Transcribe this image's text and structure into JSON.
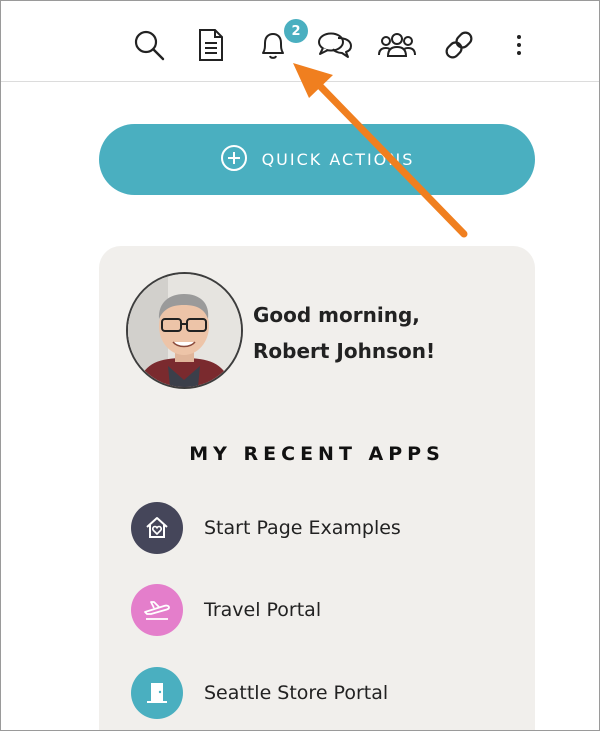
{
  "header": {
    "icons": [
      {
        "name": "search-icon"
      },
      {
        "name": "document-icon"
      },
      {
        "name": "bell-icon"
      },
      {
        "name": "chat-icon"
      },
      {
        "name": "people-icon"
      },
      {
        "name": "link-icon"
      },
      {
        "name": "more-vertical-icon"
      }
    ],
    "notification_count": "2"
  },
  "quick_actions": {
    "label": "QUICK ACTIONS",
    "icon": "plus-circle-icon"
  },
  "card": {
    "greeting_line1": "Good morning,",
    "greeting_line2": "Robert Johnson!",
    "section_title": "MY RECENT APPS",
    "apps": [
      {
        "label": "Start Page Examples",
        "icon": "home-heart-icon",
        "color": "#45465a"
      },
      {
        "label": "Travel Portal",
        "icon": "plane-icon",
        "color": "#e47ecb"
      },
      {
        "label": "Seattle Store Portal",
        "icon": "store-door-icon",
        "color": "#4aafc0"
      }
    ]
  },
  "colors": {
    "accent": "#4aafc0",
    "card_bg": "#f1efec",
    "annotation_arrow": "#f07f1f"
  }
}
